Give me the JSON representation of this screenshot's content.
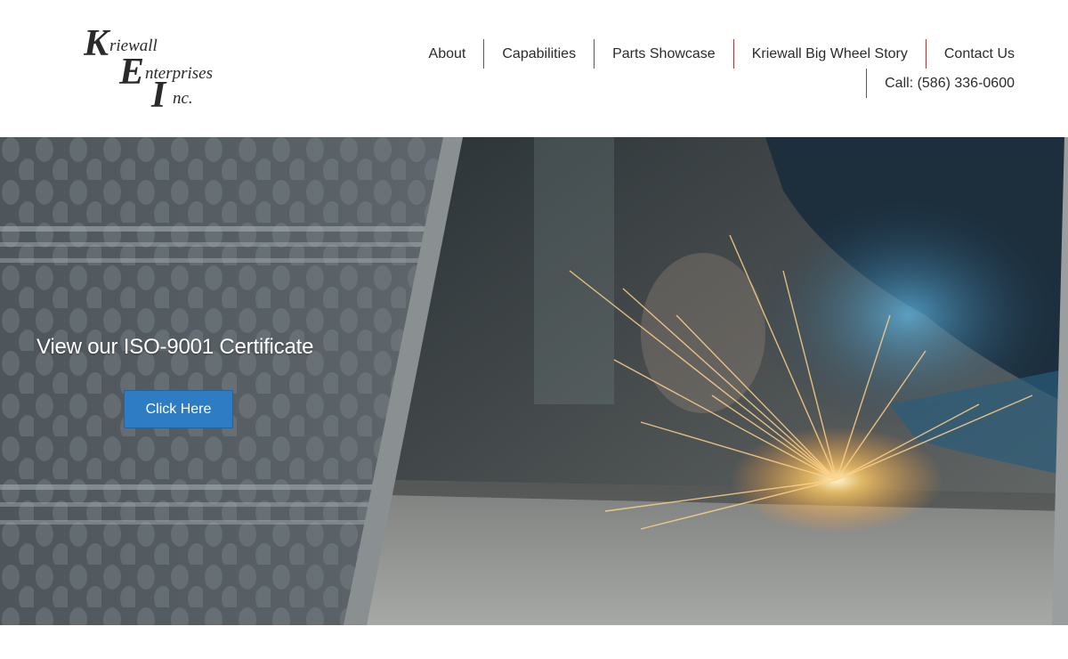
{
  "logo": {
    "line1": "Kriewall",
    "line2": "Enterprises",
    "line3": "Inc."
  },
  "nav": {
    "items": [
      {
        "label": "About"
      },
      {
        "label": "Capabilities"
      },
      {
        "label": "Parts Showcase"
      },
      {
        "label": "Kriewall Big Wheel Story"
      },
      {
        "label": "Contact Us"
      }
    ],
    "phone": "Call: (586) 336-0600"
  },
  "hero": {
    "heading": "View our ISO-9001 Certificate",
    "button_label": "Click Here"
  },
  "colors": {
    "nav_divider": "#a23c3c",
    "button": "#2e7dc4",
    "text": "#2b2b2b"
  }
}
